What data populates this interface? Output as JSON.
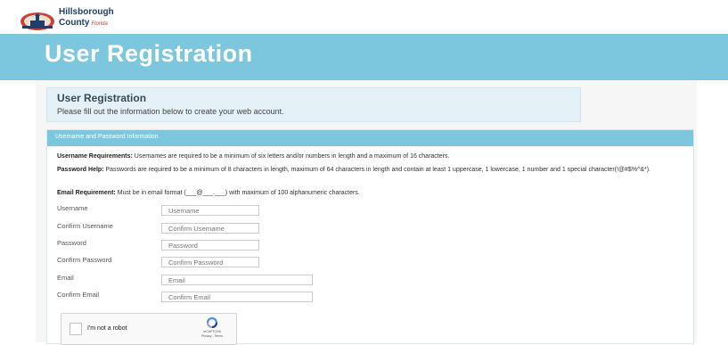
{
  "header": {
    "logo_line1": "Hillsborough",
    "logo_line2": "County",
    "logo_line3": "Florida"
  },
  "hero": {
    "title": "User Registration"
  },
  "intro": {
    "title": "User Registration",
    "subtitle": "Please fill out the information below to create your web account."
  },
  "panel": {
    "heading": "Username and Password Information",
    "username_req_label": "Username Requirements:",
    "username_req_text": " Usernames are required to be a minimum of six letters and/or numbers in length and a maximum of 16 characters.",
    "password_help_label": "Password Help:",
    "password_help_text": " Passwords are required to be a minimum of 8 characters in length, maximum of 64 characters in length and contain at least 1 uppercase, 1 lowercase, 1 number and 1 special character(!@#$%^&*).",
    "email_req_label": "Email Requirement:",
    "email_req_text": " Must be in email format (___@___.___) with maximum of 100 alphanumeric characters."
  },
  "form": {
    "fields": [
      {
        "label": "Username",
        "placeholder": "Username"
      },
      {
        "label": "Confirm Username",
        "placeholder": "Confirm Username"
      },
      {
        "label": "Password",
        "placeholder": "Password"
      },
      {
        "label": "Confirm Password",
        "placeholder": "Confirm Password"
      },
      {
        "label": "Email",
        "placeholder": "Email"
      },
      {
        "label": "Confirm Email",
        "placeholder": "Confirm Email"
      }
    ]
  },
  "captcha": {
    "label": "I'm not a robot",
    "brand": "reCAPTCHA",
    "links": "Privacy - Terms"
  },
  "colors": {
    "banner": "#7cc7de",
    "intro_bg": "#e4f1f7",
    "brand_navy": "#1d3f6e"
  }
}
